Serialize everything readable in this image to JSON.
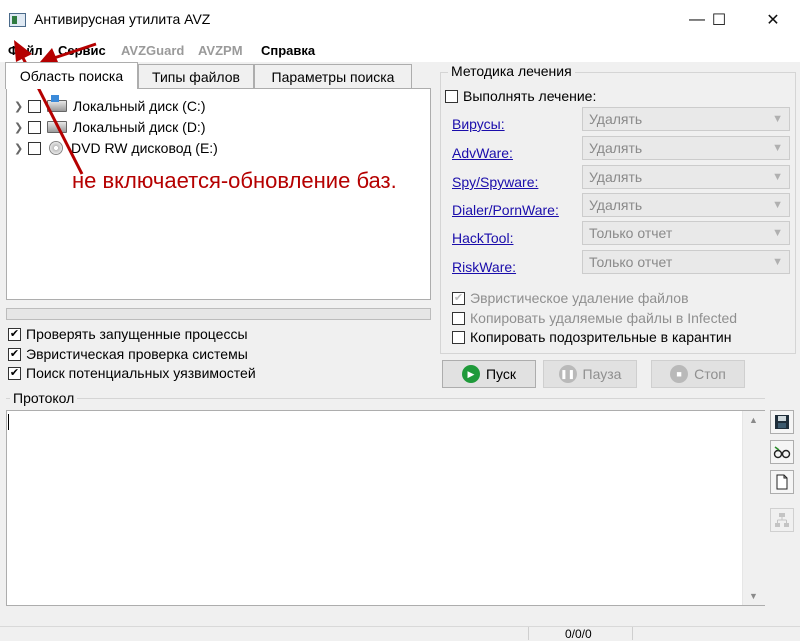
{
  "window": {
    "title": "Антивирусная утилита AVZ",
    "minimize": "—",
    "maximize": "☐",
    "close": "✕"
  },
  "menu": [
    "Файл",
    "Сервис",
    "AVZGuard",
    "AVZPM",
    "Справка"
  ],
  "tabs": [
    "Область поиска",
    "Типы файлов",
    "Параметры поиска"
  ],
  "drives": [
    {
      "label": "Локальный диск (C:)"
    },
    {
      "label": "Локальный диск (D:)"
    },
    {
      "label": "DVD RW дисковод (E:)"
    }
  ],
  "options": [
    {
      "label": "Проверять запущенные процессы",
      "checked": true
    },
    {
      "label": "Эвристическая проверка системы",
      "checked": true
    },
    {
      "label": "Поиск потенциальных уязвимостей",
      "checked": true
    }
  ],
  "treatment": {
    "group_label": "Методика лечения",
    "perform_label": "Выполнять лечение:",
    "rows": [
      {
        "link": "Вирусы:",
        "value": "Удалять"
      },
      {
        "link": "AdvWare:",
        "value": "Удалять"
      },
      {
        "link": "Spy/Spyware:",
        "value": "Удалять"
      },
      {
        "link": "Dialer/PornWare:",
        "value": "Удалять"
      },
      {
        "link": "HackTool:",
        "value": "Только отчет"
      },
      {
        "link": "RiskWare:",
        "value": "Только отчет"
      }
    ],
    "heuristic_delete": "Эвристическое удаление файлов",
    "copy_deleted": "Копировать удаляемые файлы в  Infected",
    "copy_suspicious": "Копировать подозрительные в  карантин"
  },
  "buttons": {
    "start": "Пуск",
    "pause": "Пауза",
    "stop": "Стоп"
  },
  "log": {
    "label": "Протокол"
  },
  "status": {
    "counter": "0/0/0"
  },
  "annotation": {
    "text": "не включается-обновление баз."
  },
  "colors": {
    "link": "#1a0dab",
    "annotation": "#b50000",
    "start_icon": "#1f9a3a"
  }
}
